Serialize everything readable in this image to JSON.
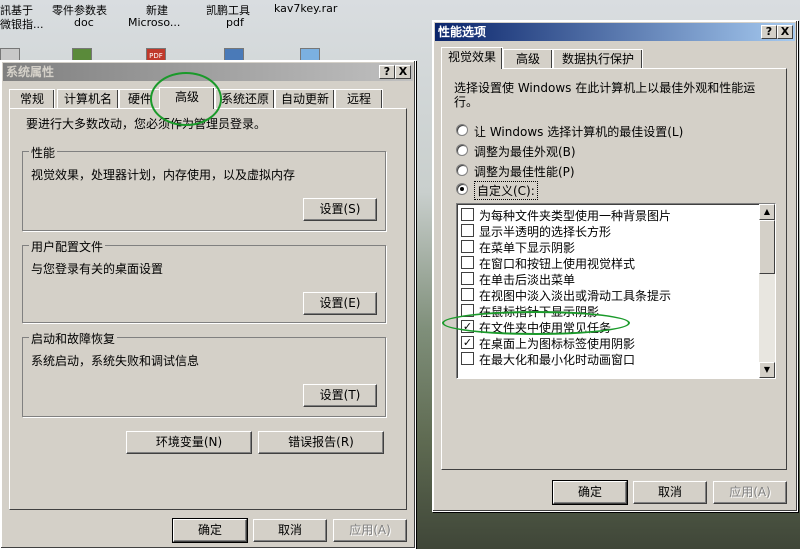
{
  "desktop": {
    "top_labels": [
      "訊基于",
      "零件参数表",
      "新建",
      "凯鹏工具",
      "kav7key.rar"
    ],
    "bottom_labels": [
      "微银指...",
      "doc",
      "Microso...",
      "pdf"
    ],
    "pdf_icon_text": "PDF"
  },
  "sysprops": {
    "title": "系统属性",
    "help": "?",
    "close": "X",
    "tabs": [
      "常规",
      "计算机名",
      "硬件",
      "高级",
      "系统还原",
      "自动更新",
      "远程"
    ],
    "intro": "要进行大多数改动，您必须作为管理员登录。",
    "perf": {
      "title": "性能",
      "desc": "视觉效果，处理器计划，内存使用，以及虚拟内存",
      "btn": "设置(S)"
    },
    "profile": {
      "title": "用户配置文件",
      "desc": "与您登录有关的桌面设置",
      "btn": "设置(E)"
    },
    "startup": {
      "title": "启动和故障恢复",
      "desc": "系统启动，系统失败和调试信息",
      "btn": "设置(T)"
    },
    "env_btn": "环境变量(N)",
    "err_btn": "错误报告(R)",
    "ok": "确定",
    "cancel": "取消",
    "apply": "应用(A)"
  },
  "perfopts": {
    "title": "性能选项",
    "help": "?",
    "close": "X",
    "tabs": [
      "视觉效果",
      "高级",
      "数据执行保护"
    ],
    "intro_line1": "选择设置使 Windows 在此计算机上以最佳外观和性能运",
    "intro_line2": "行。",
    "radios": [
      {
        "label": "让 Windows 选择计算机的最佳设置(L)",
        "checked": false
      },
      {
        "label": "调整为最佳外观(B)",
        "checked": false
      },
      {
        "label": "调整为最佳性能(P)",
        "checked": false
      },
      {
        "label": "自定义(C):",
        "checked": true
      }
    ],
    "items": [
      {
        "label": "为每种文件夹类型使用一种背景图片",
        "checked": false
      },
      {
        "label": "显示半透明的选择长方形",
        "checked": false
      },
      {
        "label": "在菜单下显示阴影",
        "checked": false
      },
      {
        "label": "在窗口和按钮上使用视觉样式",
        "checked": false
      },
      {
        "label": "在单击后淡出菜单",
        "checked": false
      },
      {
        "label": "在视图中淡入淡出或滑动工具条提示",
        "checked": false
      },
      {
        "label": "在鼠标指针下显示阴影",
        "checked": false
      },
      {
        "label": "在文件夹中使用常见任务",
        "checked": true
      },
      {
        "label": "在桌面上为图标标签使用阴影",
        "checked": true
      },
      {
        "label": "在最大化和最小化时动画窗口",
        "checked": false
      }
    ],
    "check_glyph": "✓",
    "scroll_up": "▲",
    "scroll_down": "▼",
    "ok": "确定",
    "cancel": "取消",
    "apply": "应用(A)"
  },
  "colors": {
    "highlight_ellipse": "#1a9a2a",
    "title_active": "#0a246a"
  }
}
